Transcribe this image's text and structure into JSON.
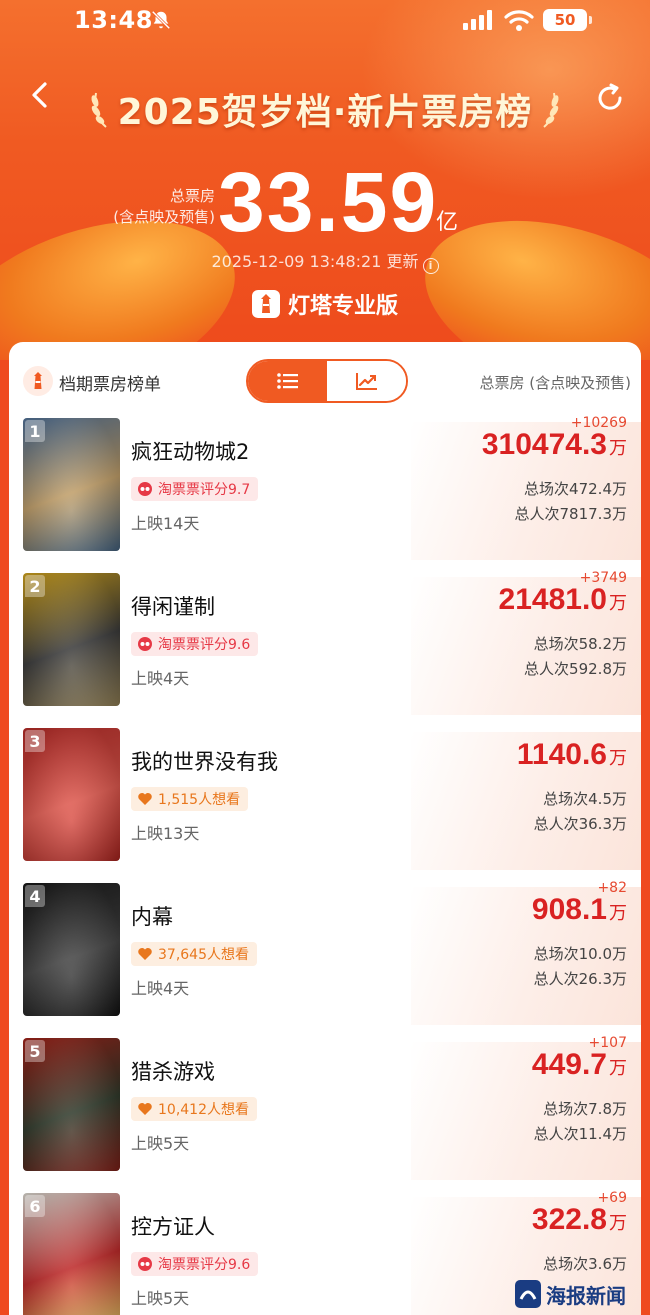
{
  "status_bar": {
    "time": "13:48",
    "battery": "50"
  },
  "header": {
    "title": "2025贺岁档·新片票房榜",
    "total_label_line1": "总票房",
    "total_label_line2": "(含点映及预售)",
    "total_value": "33.59",
    "total_unit": "亿",
    "update_time": "2025-12-09 13:48:21 更新",
    "brand": "灯塔专业版"
  },
  "card": {
    "label": "档期票房榜单",
    "right_label": "总票房 (含点映及预售)",
    "view_mode": "list"
  },
  "movies": [
    {
      "rank": "1",
      "title": "疯狂动物城2",
      "tag_type": "rating",
      "tag": "淘票票评分9.7",
      "days": "上映14天",
      "delta": "+10269",
      "gross": "310474.3",
      "unit": "万",
      "shows": "总场次472.4万",
      "admits": "总人次7817.3万",
      "poster_colors": [
        "#5a7ea8",
        "#c8a46b",
        "#3d5c7a"
      ]
    },
    {
      "rank": "2",
      "title": "得闲谨制",
      "tag_type": "rating",
      "tag": "淘票票评分9.6",
      "days": "上映4天",
      "delta": "+3749",
      "gross": "21481.0",
      "unit": "万",
      "shows": "总场次58.2万",
      "admits": "总人次592.8万",
      "poster_colors": [
        "#e6b422",
        "#3a3a3a",
        "#8c7a4f"
      ]
    },
    {
      "rank": "3",
      "title": "我的世界没有我",
      "tag_type": "want",
      "tag": "1,515人想看",
      "days": "上映13天",
      "delta": "",
      "gross": "1140.6",
      "unit": "万",
      "shows": "总场次4.5万",
      "admits": "总人次36.3万",
      "poster_colors": [
        "#c9302c",
        "#e85a4f",
        "#a31f1a"
      ]
    },
    {
      "rank": "4",
      "title": "内幕",
      "tag_type": "want",
      "tag": "37,645人想看",
      "days": "上映4天",
      "delta": "+82",
      "gross": "908.1",
      "unit": "万",
      "shows": "总场次10.0万",
      "admits": "总人次26.3万",
      "poster_colors": [
        "#1b1b1b",
        "#444",
        "#0d0d0d"
      ]
    },
    {
      "rank": "5",
      "title": "猎杀游戏",
      "tag_type": "want",
      "tag": "10,412人想看",
      "days": "上映5天",
      "delta": "+107",
      "gross": "449.7",
      "unit": "万",
      "shows": "总场次7.8万",
      "admits": "总人次11.4万",
      "poster_colors": [
        "#b3281e",
        "#2f3a2a",
        "#7a1b13"
      ]
    },
    {
      "rank": "6",
      "title": "控方证人",
      "tag_type": "rating",
      "tag": "淘票票评分9.6",
      "days": "上映5天",
      "delta": "+69",
      "gross": "322.8",
      "unit": "万",
      "shows": "总场次3.6万",
      "admits": "",
      "poster_colors": [
        "#f2efe6",
        "#c62828",
        "#e0c060"
      ]
    }
  ],
  "watermark": {
    "text": "海报新闻"
  },
  "colors": {
    "accent": "#f05a22",
    "gross_red": "#d92222",
    "rating_red": "#e63946",
    "want_orange": "#e8771d"
  }
}
